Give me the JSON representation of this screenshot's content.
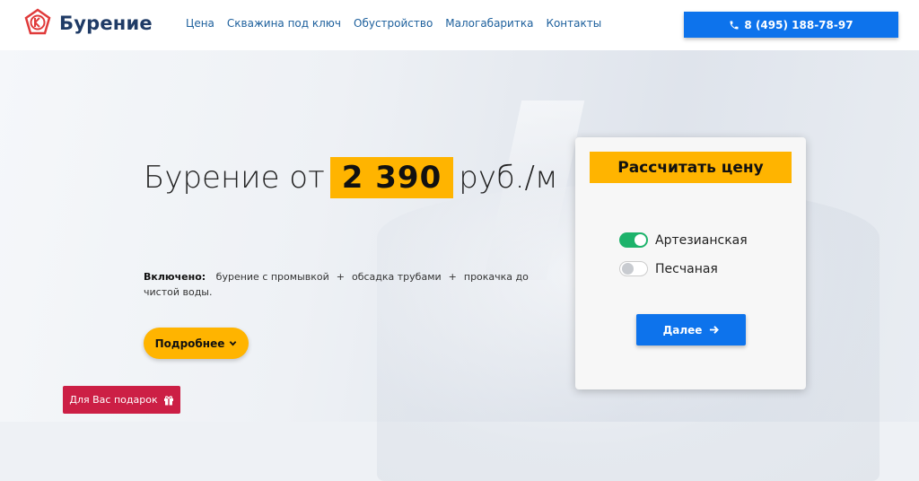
{
  "header": {
    "brand": "Бурение",
    "nav": [
      "Цена",
      "Скважина под ключ",
      "Обустройство",
      "Малогабаритка",
      "Контакты"
    ],
    "phone": "8 (495) 188-78-97"
  },
  "hero": {
    "headline_prefix": "Бурение от",
    "price": "2 390",
    "headline_suffix": "руб./м",
    "included_label": "Включено:",
    "included_items": [
      "бурение с промывкой",
      "обсадка трубами",
      "прокачка до чистой воды."
    ],
    "more_button": "Подробнее",
    "gift_button": "Для Вас подарок"
  },
  "calculator": {
    "title": "Рассчитать цену",
    "options": [
      {
        "label": "Артезианская",
        "checked": true
      },
      {
        "label": "Песчаная",
        "checked": false
      }
    ],
    "next_button": "Далее"
  },
  "colors": {
    "accent_yellow": "#ffb400",
    "primary_blue": "#0d73ec",
    "toggle_green": "#1db36b",
    "gift_red": "#cc1f45",
    "nav_link": "#1c5f9c"
  },
  "icons": {
    "logo": "k-logo-icon",
    "phone": "phone-icon",
    "more": "chevron-down-icon",
    "gift": "gift-icon",
    "next": "arrow-right-icon"
  }
}
